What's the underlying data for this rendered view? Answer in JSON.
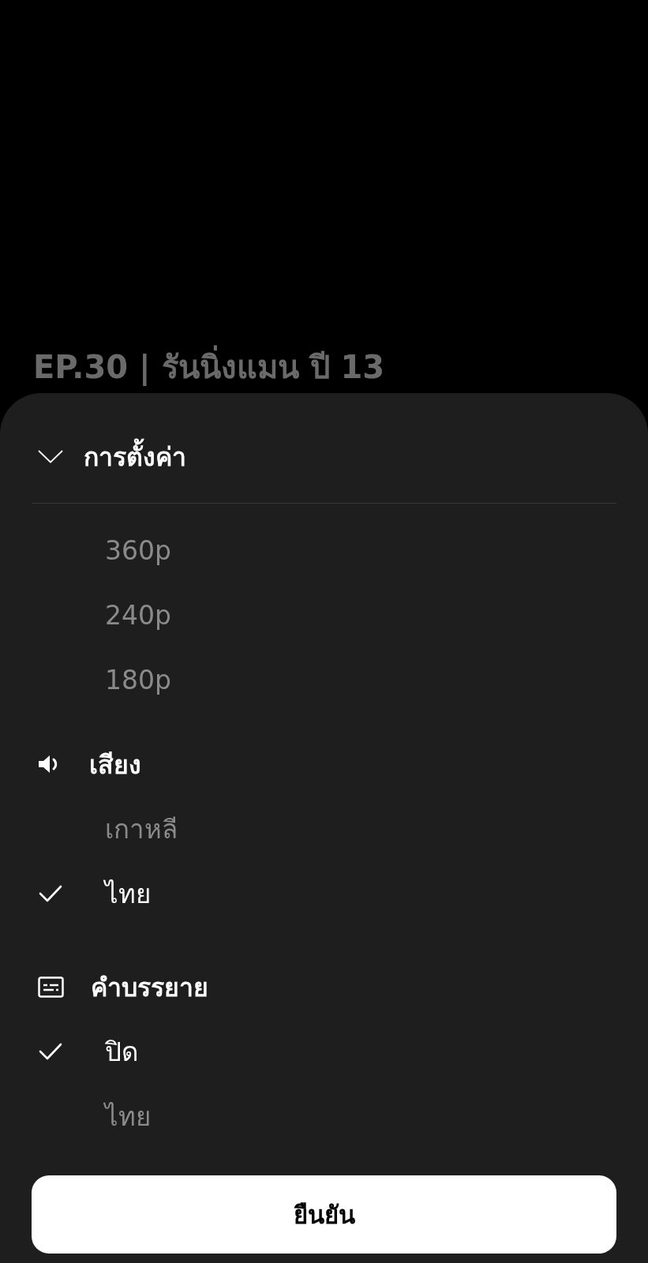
{
  "background": {
    "title": "EP.30 | รันนิ่งแมน ปี 13"
  },
  "sheet": {
    "header": {
      "title": "การตั้งค่า",
      "expanded": true
    },
    "sections": [
      {
        "kind": "quality",
        "options": [
          {
            "label": "360p",
            "selected": false
          },
          {
            "label": "240p",
            "selected": false
          },
          {
            "label": "180p",
            "selected": false
          }
        ]
      },
      {
        "kind": "audio",
        "title": "เสียง",
        "options": [
          {
            "label": "เกาหลี",
            "selected": false
          },
          {
            "label": "ไทย",
            "selected": true
          }
        ]
      },
      {
        "kind": "subtitles",
        "title": "คำบรรยาย",
        "options": [
          {
            "label": "ปิด",
            "selected": true
          },
          {
            "label": "ไทย",
            "selected": false
          }
        ]
      }
    ],
    "confirm_button": "ยืนยัน"
  }
}
